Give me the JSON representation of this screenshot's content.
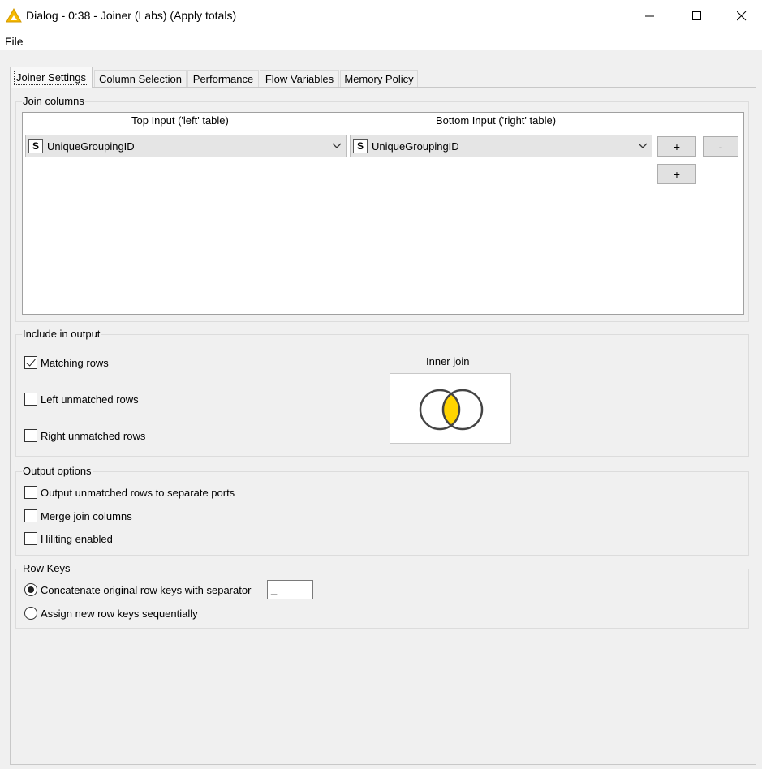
{
  "window": {
    "title": "Dialog - 0:38 - Joiner (Labs) (Apply totals)",
    "icon": "warning-triangle-icon",
    "accent_color": "#f5b800"
  },
  "menu": {
    "file": "File"
  },
  "tabs": [
    {
      "label": "Joiner Settings",
      "active": true
    },
    {
      "label": "Column Selection",
      "active": false
    },
    {
      "label": "Performance",
      "active": false
    },
    {
      "label": "Flow Variables",
      "active": false
    },
    {
      "label": "Memory Policy",
      "active": false
    }
  ],
  "join_columns": {
    "title": "Join columns",
    "left_header": "Top Input ('left' table)",
    "right_header": "Bottom Input ('right' table)",
    "rows": [
      {
        "left_type": "S",
        "left": "UniqueGroupingID",
        "right_type": "S",
        "right": "UniqueGroupingID"
      }
    ],
    "add_label": "+",
    "remove_label": "-"
  },
  "include_output": {
    "title": "Include in output",
    "matching_rows": "Matching rows",
    "left_unmatched": "Left unmatched rows",
    "right_unmatched": "Right unmatched rows",
    "matching_checked": true,
    "left_checked": false,
    "right_checked": false,
    "join_type": "Inner join",
    "venn_fill": "#ffd400"
  },
  "output_options": {
    "title": "Output options",
    "separate_ports": "Output unmatched rows to separate ports",
    "merge_columns": "Merge join columns",
    "hiliting": "Hiliting enabled"
  },
  "row_keys": {
    "title": "Row Keys",
    "concatenate": "Concatenate original row keys with separator",
    "separator": "_",
    "sequential": "Assign new row keys sequentially",
    "selected": "concatenate"
  }
}
